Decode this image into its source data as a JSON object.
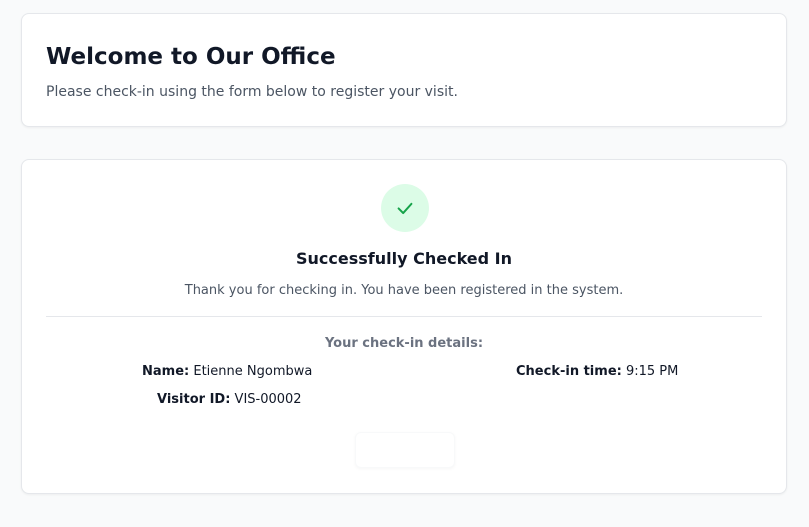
{
  "header": {
    "title": "Welcome to Our Office",
    "subtitle": "Please check-in using the form below to register your visit."
  },
  "success": {
    "icon": "check-icon",
    "title": "Successfully Checked In",
    "message": "Thank you for checking in. You have been registered in the system.",
    "details_heading": "Your check-in details:",
    "details": {
      "name_label": "Name:",
      "name_value": "Etienne Ngombwa",
      "time_label": "Check-in time:",
      "time_value": "9:15 PM",
      "id_label": "Visitor ID:",
      "id_value": "VIS-00002"
    },
    "button_label": ""
  },
  "colors": {
    "success_bg": "#dcfce7",
    "success_icon": "#16a34a"
  }
}
